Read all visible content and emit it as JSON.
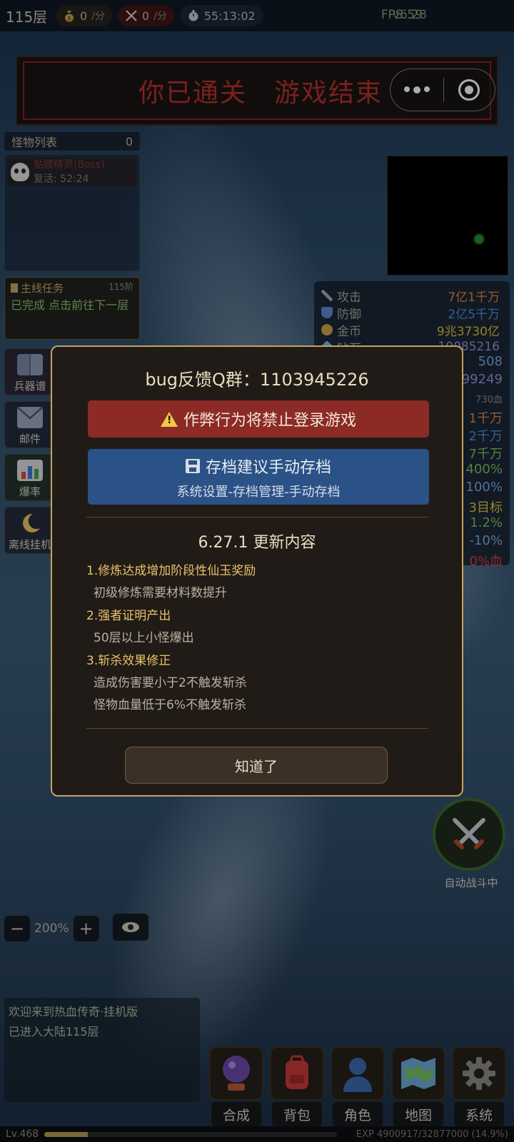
{
  "topbar": {
    "floor": "115层",
    "gold_rate": "0",
    "kill_rate": "0",
    "rate_unit": "/分",
    "timer": "55:13:02",
    "fps": "FPS:59",
    "version": "v6.28"
  },
  "banner": {
    "text": "你已通关　游戏结束"
  },
  "monster_list": {
    "title": "怪物列表",
    "count": "0",
    "items": [
      {
        "name": "骷髅精灵(Boss)",
        "respawn": "复活: 52:24"
      }
    ]
  },
  "quest": {
    "title": "主线任务",
    "level": "115阶",
    "body": "已完成 点击前往下一层"
  },
  "side_buttons": [
    {
      "label": "兵器谱",
      "icon": "book-icon"
    },
    {
      "label": "邮件",
      "icon": "mail-icon"
    },
    {
      "label": "爆率",
      "icon": "bar-chart-icon"
    },
    {
      "label": "离线挂机",
      "icon": "moon-icon"
    }
  ],
  "stats": [
    {
      "label": "攻击",
      "value": "7亿1千万",
      "color": "#e0873a",
      "icon": "sword-icon"
    },
    {
      "label": "防御",
      "value": "2亿5千万",
      "color": "#4a90e0",
      "icon": "shield-icon"
    },
    {
      "label": "金币",
      "value": "9兆3730亿",
      "color": "#d8c040",
      "icon": "coin-bag-icon"
    },
    {
      "label": "钻石",
      "value": "10085216",
      "color": "#9b8fd6",
      "icon": "gem-icon"
    }
  ],
  "stat_fragments": [
    {
      "value": "508",
      "color": "#7aa8e0"
    },
    {
      "value": "99249",
      "color": "#9b8fd6"
    },
    {
      "value": "730血",
      "color": "#8a8a8a"
    },
    {
      "value": "1千万",
      "color": "#e0873a"
    },
    {
      "value": "2千万",
      "color": "#4a90e0"
    },
    {
      "value": "7千万",
      "color": "#7ac060"
    },
    {
      "value": "400%",
      "color": "#7ac060"
    },
    {
      "value": "100%",
      "color": "#7aa8e0"
    },
    {
      "value": "3目标",
      "color": "#d8c040"
    },
    {
      "value": "1.2%",
      "color": "#7ac060"
    },
    {
      "value": "-10%",
      "color": "#7aa8e0"
    },
    {
      "value": "0%血",
      "color": "#d04040"
    }
  ],
  "auto_battle": {
    "label": "自动战斗中"
  },
  "zoom": {
    "minus": "−",
    "value": "200%",
    "plus": "+"
  },
  "log": {
    "lines": [
      "欢迎来到热血传奇·挂机版",
      "已进入大陆115层"
    ]
  },
  "dock": [
    {
      "label": "合成",
      "icon": "crystal-ball-icon"
    },
    {
      "label": "背包",
      "icon": "backpack-icon"
    },
    {
      "label": "角色",
      "icon": "character-icon"
    },
    {
      "label": "地图",
      "icon": "map-icon"
    },
    {
      "label": "系统",
      "icon": "gear-icon"
    }
  ],
  "bottom": {
    "level": "Lv.468",
    "exp_text": "EXP 4900917/32877000 (14.9%)",
    "exp_fraction": 0.149
  },
  "modal": {
    "title": "bug反馈Q群：1103945226",
    "warning": "作弊行为将禁止登录游戏",
    "save_title": "存档建议手动存档",
    "save_path": "系统设置-存档管理-手动存档",
    "update_title": "6.27.1 更新内容",
    "notes": [
      {
        "head": "1.修炼达成增加阶段性仙玉奖励",
        "lines": [
          "初级修炼需要材料数提升"
        ]
      },
      {
        "head": "2.强者证明产出",
        "lines": [
          "50层以上小怪爆出"
        ]
      },
      {
        "head": "3.斩杀效果修正",
        "lines": [
          "造成伤害要小于2不触发斩杀",
          "怪物血量低于6%不触发斩杀"
        ]
      }
    ],
    "ok": "知道了"
  }
}
